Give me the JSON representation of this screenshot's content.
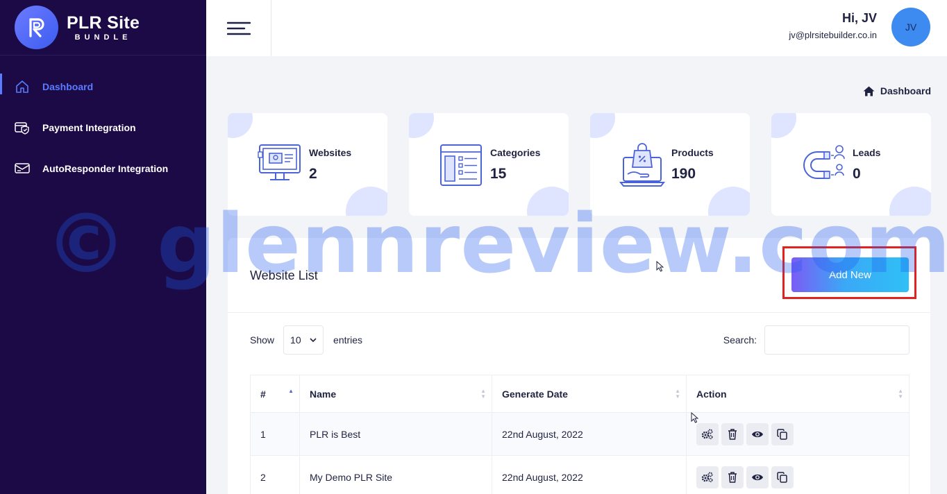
{
  "brand": {
    "title": "PLR Site",
    "subtitle": "BUNDLE"
  },
  "sidebar": {
    "items": [
      {
        "label": "Dashboard",
        "icon": "home-icon",
        "active": true
      },
      {
        "label": "Payment Integration",
        "icon": "payment-icon",
        "active": false
      },
      {
        "label": "AutoResponder Integration",
        "icon": "autoresponder-icon",
        "active": false
      }
    ]
  },
  "header": {
    "greeting": "Hi, JV",
    "email": "jv@plrsitebuilder.co.in",
    "avatar_initials": "JV"
  },
  "breadcrumb": {
    "label": "Dashboard"
  },
  "stats": [
    {
      "label": "Websites",
      "value": "2",
      "icon": "website-icon"
    },
    {
      "label": "Categories",
      "value": "15",
      "icon": "categories-icon"
    },
    {
      "label": "Products",
      "value": "190",
      "icon": "products-icon"
    },
    {
      "label": "Leads",
      "value": "0",
      "icon": "leads-magnet-icon"
    }
  ],
  "website_list": {
    "title": "Website List",
    "add_new_label": "Add New",
    "show_label": "Show",
    "entries_value": "10",
    "entries_label": "entries",
    "search_label": "Search:",
    "columns": [
      "#",
      "Name",
      "Generate Date",
      "Action"
    ],
    "rows": [
      {
        "num": "1",
        "name": "PLR is Best",
        "date": "22nd August, 2022"
      },
      {
        "num": "2",
        "name": "My Demo PLR Site",
        "date": "22nd August, 2022"
      }
    ],
    "action_icons": [
      "settings-icon",
      "trash-icon",
      "eye-icon",
      "copy-icon"
    ]
  },
  "watermark": {
    "text": "© glennreview.com"
  },
  "colors": {
    "sidebar_bg": "#1b0a45",
    "accent": "#5a7cff",
    "highlight": "#e0231e"
  }
}
